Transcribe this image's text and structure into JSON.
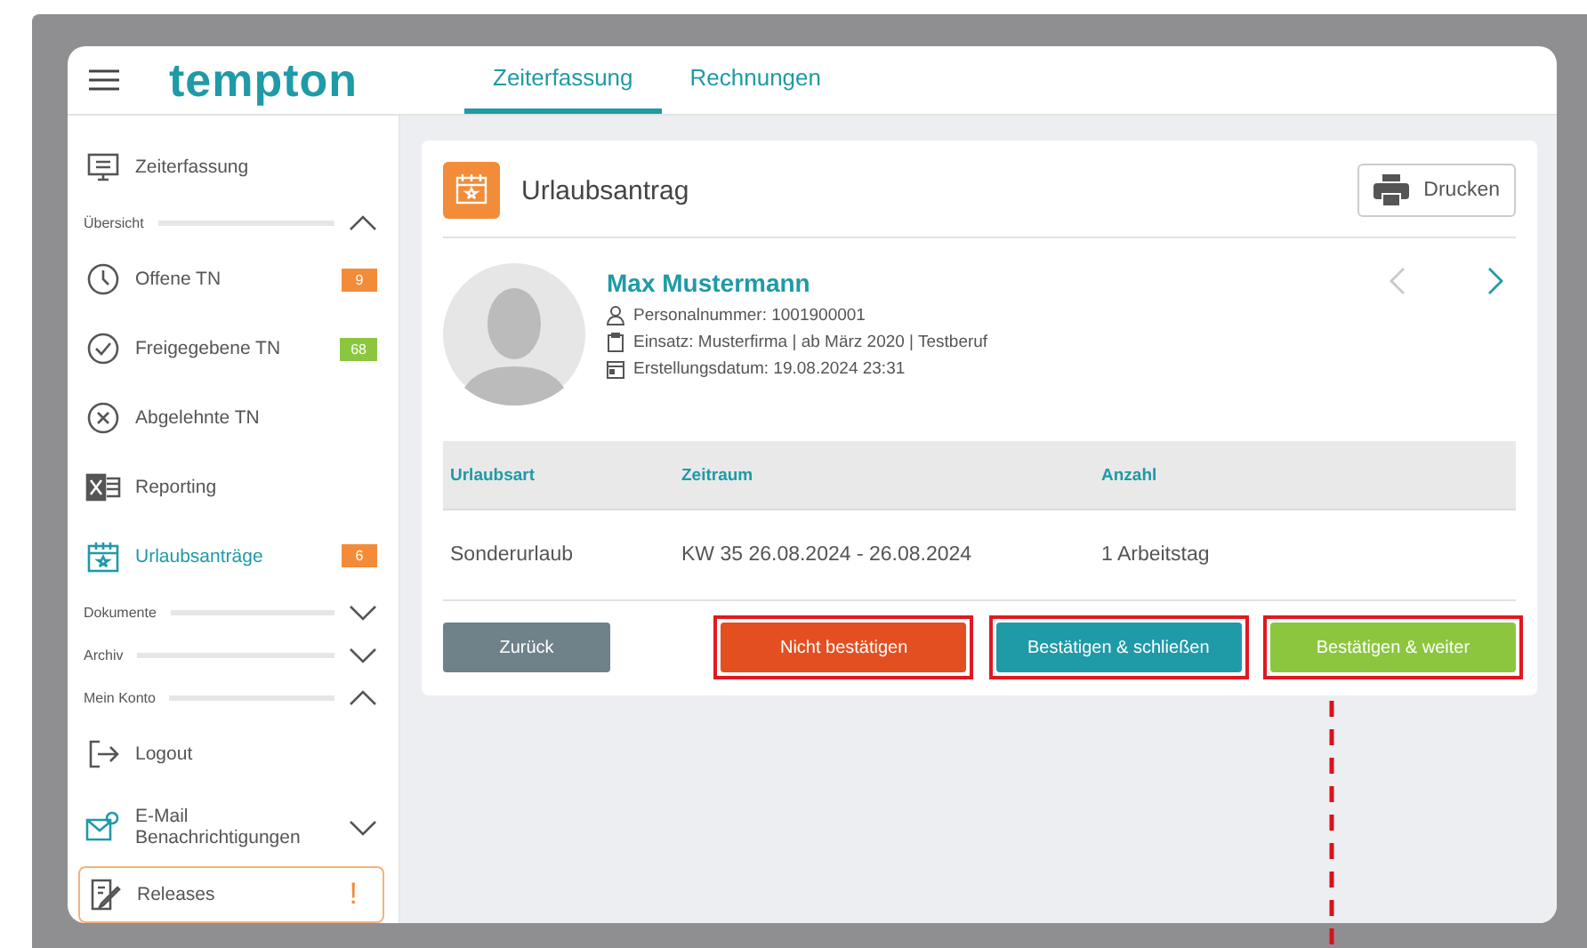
{
  "header": {
    "logo": "tempton",
    "tabs": [
      {
        "label": "Zeiterfassung",
        "selected": true
      },
      {
        "label": "Rechnungen",
        "selected": false
      }
    ]
  },
  "sidebar": {
    "items": [
      {
        "kind": "link",
        "label": "Zeiterfassung",
        "selected": false
      },
      {
        "kind": "section",
        "label": "Übersicht",
        "expanded": true
      },
      {
        "kind": "link",
        "label": "Offene TN",
        "badge": "9",
        "color": "#f28c38",
        "selected": false
      },
      {
        "kind": "link",
        "label": "Freigegebene TN",
        "badge": "68",
        "color": "#8cc63f",
        "selected": false
      },
      {
        "kind": "link",
        "label": "Abgelehnte TN",
        "selected": false
      },
      {
        "kind": "link",
        "label": "Reporting",
        "selected": false
      },
      {
        "kind": "link",
        "label": "Urlaubsanträge",
        "badge": "6",
        "color": "#f28c38",
        "selected": true
      },
      {
        "kind": "section",
        "label": "Dokumente",
        "expanded": false
      },
      {
        "kind": "section",
        "label": "Archiv",
        "expanded": false
      },
      {
        "kind": "section",
        "label": "Mein Konto",
        "expanded": true
      },
      {
        "kind": "link",
        "label": "Logout",
        "selected": false
      },
      {
        "kind": "group",
        "label": "E-Mail Benachrichtigungen",
        "expanded": false
      },
      {
        "kind": "alert",
        "label": "Releases",
        "mark": "!"
      }
    ]
  },
  "card": {
    "title": "Urlaubsantrag",
    "print_button": "Drucken",
    "person": {
      "name": "Max Mustermann",
      "lines": [
        {
          "text": "Personalnummer: 1001900001"
        },
        {
          "text": "Einsatz: Musterfirma | ab März 2020 | Testberuf"
        },
        {
          "text": "Erstellungsdatum: 19.08.2024 23:31"
        }
      ],
      "prev_disabled": true,
      "next_disabled": false
    },
    "table": {
      "columns": [
        "Urlaubsart",
        "Zeitraum",
        "Anzahl"
      ],
      "rows": [
        [
          "Sonderurlaub",
          "KW 35 26.08.2024 - 26.08.2024",
          "1 Arbeitstag"
        ]
      ]
    },
    "buttons": [
      {
        "kind": "back",
        "label": "Zurück",
        "highlighted": false
      },
      {
        "kind": "reject",
        "label": "Nicht bestätigen",
        "highlighted": true
      },
      {
        "kind": "confirm",
        "label": "Bestätigen & schließen",
        "highlighted": true
      },
      {
        "kind": "next",
        "label": "Bestätigen & weiter",
        "highlighted": true
      }
    ]
  }
}
